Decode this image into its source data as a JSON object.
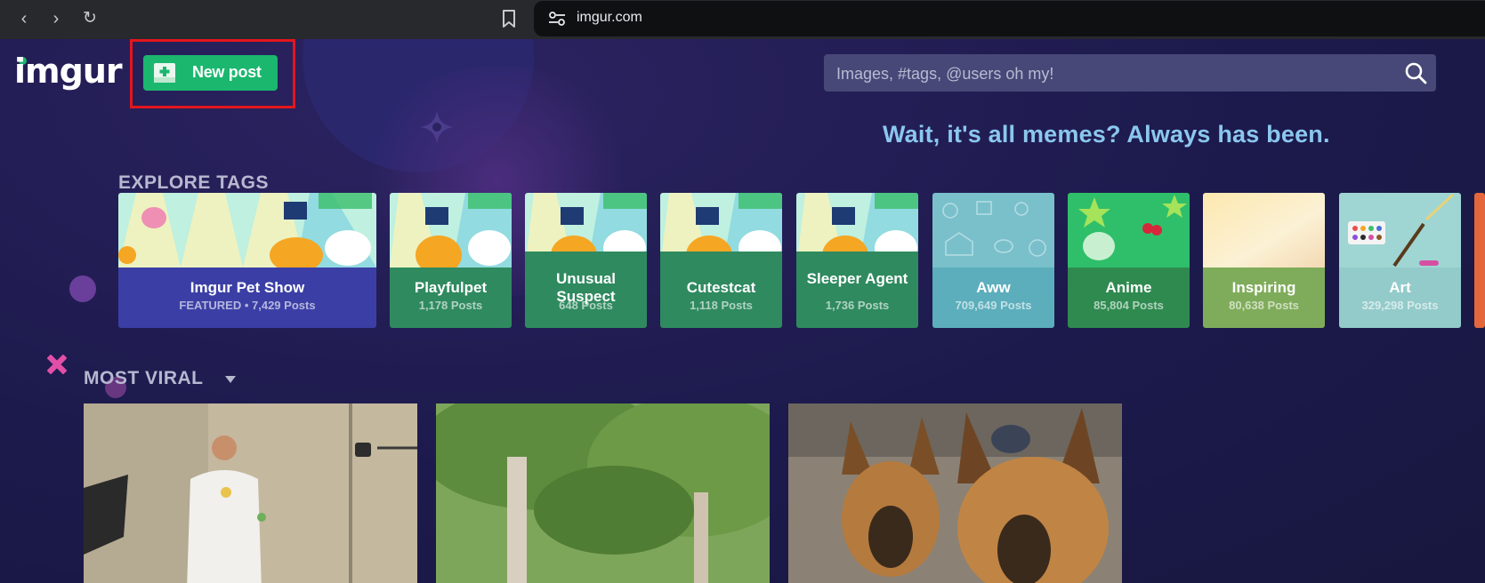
{
  "browser": {
    "back_glyph": "‹",
    "forward_glyph": "›",
    "reload_glyph": "↻",
    "url": "imgur.com"
  },
  "header": {
    "logo_text": "imgur",
    "new_post_label": "New post",
    "search_placeholder": "Images, #tags, @users oh my!",
    "tagline": "Wait, it's all memes? Always has been."
  },
  "explore": {
    "title": "EXPLORE TAGS",
    "tags": [
      {
        "name": "Imgur Pet Show",
        "count": "FEATURED • 7,429 Posts",
        "color": "#3b3fa5",
        "image": "pet-show-illustration"
      },
      {
        "name": "Playfulpet",
        "count": "1,178 Posts",
        "color": "#2f8a5f",
        "image": "pet-show-illustration"
      },
      {
        "name": "Unusual Suspect",
        "count": "648 Posts",
        "color": "#2f8a5f",
        "image": "pet-show-illustration"
      },
      {
        "name": "Cutestcat",
        "count": "1,118 Posts",
        "color": "#2f8a5f",
        "image": "pet-show-illustration"
      },
      {
        "name": "Sleeper Agent",
        "count": "1,736 Posts",
        "color": "#2f8a5f",
        "image": "pet-show-illustration"
      },
      {
        "name": "Aww",
        "count": "709,649 Posts",
        "color": "#5caebc",
        "image": "pet-doodle-pattern"
      },
      {
        "name": "Anime",
        "count": "85,804 Posts",
        "color": "#2f8a4f",
        "image": "anime-stars-pattern"
      },
      {
        "name": "Inspiring",
        "count": "80,638 Posts",
        "color": "#7fac5a",
        "image": "sunrise-gradient"
      },
      {
        "name": "Art",
        "count": "329,298 Posts",
        "color": "#93cbca",
        "image": "paint-palette"
      }
    ]
  },
  "viral": {
    "title": "MOST VIRAL",
    "posts": [
      {
        "image": "man-juggling-photo"
      },
      {
        "image": "green-tree-photo"
      },
      {
        "image": "two-german-shepherds-photo"
      }
    ]
  },
  "colors": {
    "background": "#1b1a4a",
    "accent_green": "#1bb76e",
    "tagline_blue": "#8bc7ee",
    "highlight_red": "#e3161c",
    "search_bg": "#474877"
  }
}
